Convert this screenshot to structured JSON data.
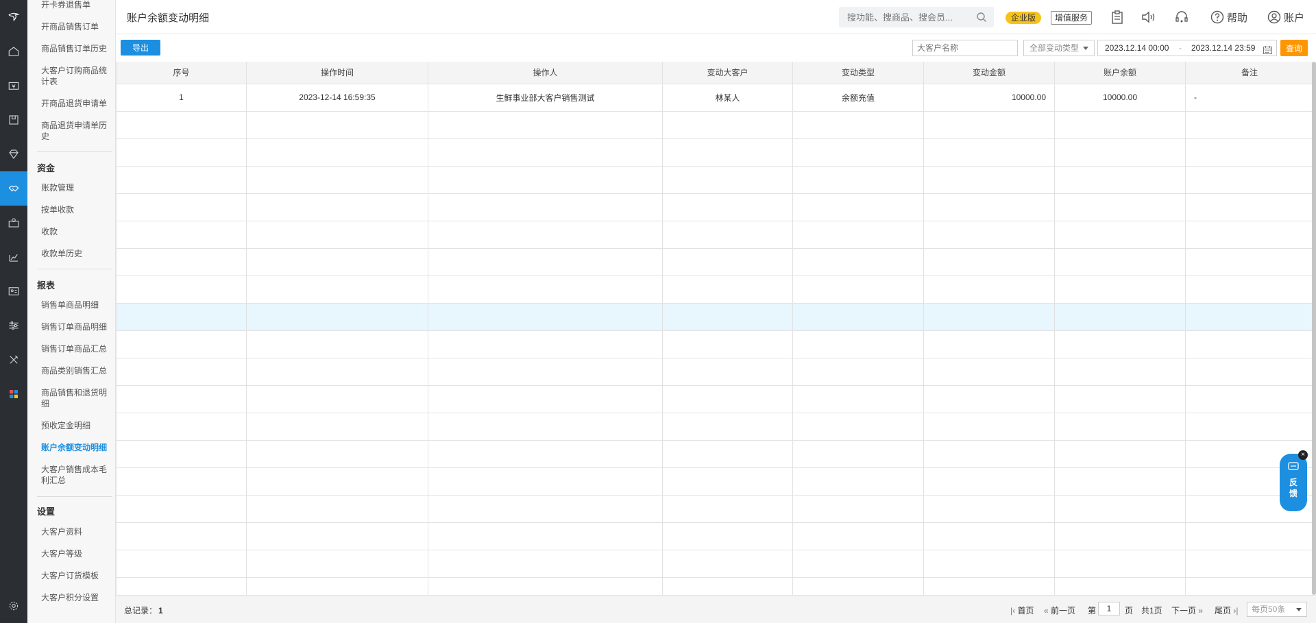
{
  "page": {
    "title": "账户余额变动明细"
  },
  "header": {
    "search_placeholder": "搜功能、搜商品、搜会员...",
    "badge": "企业版",
    "vas_button": "增值服务",
    "help": "帮助",
    "account": "账户"
  },
  "rail": {
    "icons": [
      "logo-icon",
      "home-icon",
      "cashier-icon",
      "products-icon",
      "member-icon",
      "wholesale-icon",
      "supplier-icon",
      "report-icon",
      "staff-icon",
      "settings-sliders-icon",
      "tools-icon",
      "apps-icon",
      "gear-icon"
    ],
    "active": "wholesale-icon"
  },
  "subnav": {
    "items_top": [
      "开卡券退售单",
      "开商品销售订单",
      "商品销售订单历史",
      "大客户订购商品统计表",
      "开商品退货申请单",
      "商品退货申请单历史"
    ],
    "groups": [
      {
        "title": "资金",
        "items": [
          "账款管理",
          "按单收款",
          "收款",
          "收款单历史"
        ]
      },
      {
        "title": "报表",
        "items": [
          "销售单商品明细",
          "销售订单商品明细",
          "销售订单商品汇总",
          "商品类别销售汇总",
          "商品销售和退货明细",
          "预收定金明细",
          "账户余额变动明细",
          "大客户销售成本毛利汇总"
        ]
      },
      {
        "title": "设置",
        "items": [
          "大客户资料",
          "大客户等级",
          "大客户订货模板",
          "大客户积分设置"
        ]
      }
    ],
    "active_item": "账户余额变动明细"
  },
  "toolbar": {
    "export_label": "导出",
    "customer_placeholder": "大客户名称",
    "type_select": "全部变动类型",
    "date_from": "2023.12.14 00:00",
    "date_sep": "-",
    "date_to": "2023.12.14 23:59",
    "query_label": "查询"
  },
  "table": {
    "columns": [
      "序号",
      "操作时间",
      "操作人",
      "变动大客户",
      "变动类型",
      "变动金额",
      "账户余额",
      "备注"
    ],
    "rows": [
      [
        "1",
        "2023-12-14 16:59:35",
        "生鲜事业部大客户销售测试",
        "林某人",
        "余额充值",
        "10000.00",
        "10000.00",
        "-"
      ]
    ],
    "empty_rows": 18,
    "highlighted_row_index": 8
  },
  "footer": {
    "total_label": "总记录：",
    "total_value": "1",
    "first": "首页",
    "prev": "前一页",
    "page_prefix": "第",
    "page_value": "1",
    "page_suffix": "页",
    "total_pages": "共1页",
    "next": "下一页",
    "last": "尾页",
    "page_size": "每页50条"
  },
  "feedback": {
    "label": "反馈",
    "close": "×"
  },
  "colors": {
    "accent": "#1d8fe1",
    "query": "#ff9600",
    "badge": "#f7c21c",
    "rail": "#2b2e33",
    "highlight_row": "#e8f6fd"
  }
}
